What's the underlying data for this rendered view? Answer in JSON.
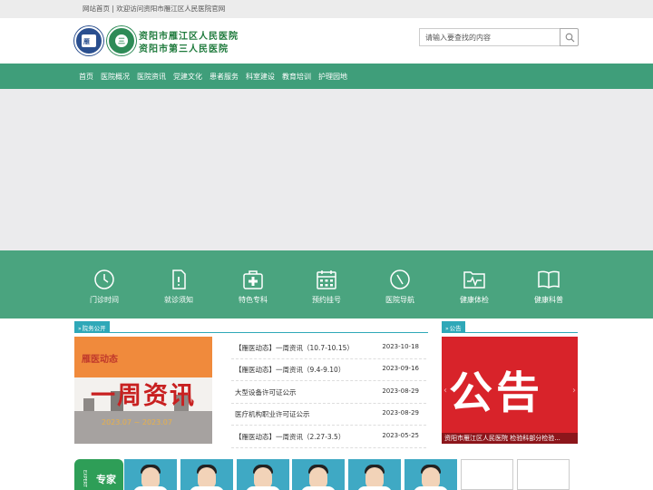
{
  "topbar": {
    "text": "网站首页 | 欢迎访问资阳市雁江区人民医院官网"
  },
  "header": {
    "logo1_text": "雁",
    "logo2_text": "三",
    "name_line1": "资阳市雁江区人民医院",
    "name_line2": "资阳市第三人民医院"
  },
  "search": {
    "placeholder": "请输入要查找的内容",
    "icon": "search-icon"
  },
  "nav": {
    "items": [
      {
        "label": "首页"
      },
      {
        "label": "医院概况"
      },
      {
        "label": "医院资讯"
      },
      {
        "label": "党建文化"
      },
      {
        "label": "患者服务"
      },
      {
        "label": "科室建设"
      },
      {
        "label": "教育培训"
      },
      {
        "label": "护理园地"
      }
    ]
  },
  "services": [
    {
      "label": "门诊时间",
      "icon": "clock-icon"
    },
    {
      "label": "就诊须知",
      "icon": "document-icon"
    },
    {
      "label": "特色专科",
      "icon": "medical-kit-icon"
    },
    {
      "label": "预约挂号",
      "icon": "calendar-icon"
    },
    {
      "label": "医院导航",
      "icon": "compass-icon"
    },
    {
      "label": "健康体检",
      "icon": "checkup-icon"
    },
    {
      "label": "健康科普",
      "icon": "book-icon"
    }
  ],
  "news": {
    "tag": "院务公开",
    "image_title": "雁医动态",
    "image_headline": "一周资讯",
    "image_date": "2023.07 ~ 2023.07",
    "items": [
      {
        "title": "【雁医动态】一周资讯（10.7-10.15）",
        "date": "2023-10-18"
      },
      {
        "title": "【雁医动态】一周资讯（9.4-9.10）",
        "date": "2023-09-16"
      },
      {
        "title": "大型设备许可证公示",
        "date": "2023-08-29"
      },
      {
        "title": "医疗机构职业许可证公示",
        "date": "2023-08-29"
      },
      {
        "title": "【雁医动态】一周资讯（2.27-3.5）",
        "date": "2023-05-25"
      }
    ]
  },
  "notice": {
    "tag": "公告",
    "headline": "公告",
    "caption": "资阳市雁江区人民医院 检验科部分检验..."
  },
  "experts": {
    "en": "EXPERT",
    "cn": "专家"
  },
  "colors": {
    "nav_green": "#3f9e7a",
    "service_green": "#4aa47f",
    "tag_teal": "#2fa8b8",
    "notice_red": "#d8232a"
  }
}
